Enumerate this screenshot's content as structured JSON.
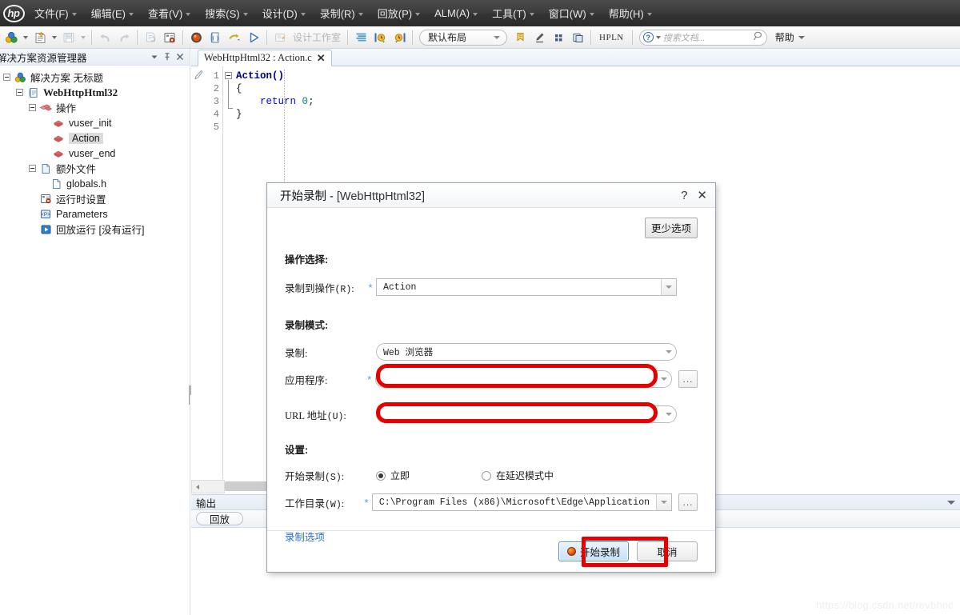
{
  "app": {
    "logo_text": "hp",
    "watermark": "https://blog.csdn.net/revbhnc"
  },
  "menubar": {
    "items": [
      {
        "label": "文件(F)",
        "icon": "chevron-down-icon"
      },
      {
        "label": "编辑(E)",
        "icon": "chevron-down-icon"
      },
      {
        "label": "查看(V)",
        "icon": "chevron-down-icon"
      },
      {
        "label": "搜索(S)",
        "icon": "chevron-down-icon"
      },
      {
        "label": "设计(D)",
        "icon": "chevron-down-icon"
      },
      {
        "label": "录制(R)",
        "icon": "chevron-down-icon"
      },
      {
        "label": "回放(P)",
        "icon": "chevron-down-icon"
      },
      {
        "label": "ALM(A)",
        "icon": "chevron-down-icon"
      },
      {
        "label": "工具(T)",
        "icon": "chevron-down-icon"
      },
      {
        "label": "窗口(W)",
        "icon": "chevron-down-icon"
      },
      {
        "label": "帮助(H)",
        "icon": "chevron-down-icon"
      }
    ]
  },
  "toolbar": {
    "design_studio_label": "设计工作室",
    "hpln_label": "HPLN",
    "layout_value": "默认布局",
    "search_placeholder": "搜索文档...",
    "help_label": "帮助"
  },
  "solution_explorer": {
    "title": "解决方案资源管理器",
    "header_buttons": [
      {
        "name": "dropdown-icon"
      },
      {
        "name": "pin-icon"
      },
      {
        "name": "close-icon"
      }
    ],
    "tree": [
      {
        "label": "解决方案 无标题",
        "icon": "solution-icon",
        "depth": 0,
        "expander": "minus"
      },
      {
        "label": "WebHttpHtml32",
        "icon": "script-icon",
        "depth": 1,
        "expander": "minus",
        "bold": true
      },
      {
        "label": "操作",
        "icon": "actions-folder-icon",
        "depth": 2,
        "expander": "minus"
      },
      {
        "label": "vuser_init",
        "icon": "action-icon",
        "depth": 3,
        "expander": "none"
      },
      {
        "label": "Action",
        "icon": "action-icon",
        "depth": 3,
        "expander": "none",
        "selected": true
      },
      {
        "label": "vuser_end",
        "icon": "action-icon",
        "depth": 3,
        "expander": "none"
      },
      {
        "label": "额外文件",
        "icon": "file-folder-icon",
        "depth": 2,
        "expander": "minus"
      },
      {
        "label": "globals.h",
        "icon": "header-file-icon",
        "depth": 3,
        "expander": "none"
      },
      {
        "label": "运行时设置",
        "icon": "runtime-settings-icon",
        "depth": 2,
        "expander": "none"
      },
      {
        "label": "Parameters",
        "icon": "parameters-icon",
        "depth": 2,
        "expander": "none"
      },
      {
        "label": "回放运行 [没有运行]",
        "icon": "replay-run-icon",
        "depth": 2,
        "expander": "none"
      }
    ]
  },
  "editor": {
    "tab_label": "WebHttpHtml32 : Action.c",
    "tab_close_icon": "close-icon",
    "line_numbers": [
      "1",
      "2",
      "3",
      "4",
      "5"
    ],
    "code_lines": [
      {
        "tokens": [
          {
            "t": "Action()",
            "c": "fn"
          }
        ]
      },
      {
        "tokens": [
          {
            "t": "{",
            "c": ""
          }
        ]
      },
      {
        "tokens": [
          {
            "t": "    ",
            "c": ""
          },
          {
            "t": "return",
            "c": "kw2"
          },
          {
            "t": " ",
            "c": ""
          },
          {
            "t": "0",
            "c": "num"
          },
          {
            "t": ";",
            "c": ""
          }
        ]
      },
      {
        "tokens": [
          {
            "t": "}",
            "c": ""
          }
        ]
      },
      {
        "tokens": [
          {
            "t": "",
            "c": ""
          }
        ]
      }
    ]
  },
  "output_panel": {
    "title": "输出",
    "collapse_icon": "chevron-down-icon",
    "tabs": [
      {
        "label": "回放"
      }
    ]
  },
  "dialog": {
    "title_prefix": "开始录制 - ",
    "title_project": "[WebHttpHtml32]",
    "help_icon": "question-mark-icon",
    "close_icon": "close-icon",
    "more_options_label": "更少选项",
    "section_action": "操作选择:",
    "record_into_label": "录制到操作",
    "record_into_key": "(R)",
    "record_into_value": "Action",
    "section_mode": "录制模式:",
    "record_label": "录制:",
    "record_value": "Web 浏览器",
    "app_label": "应用程序:",
    "app_value": "",
    "url_label": "URL 地址",
    "url_key": "(U)",
    "url_value": "",
    "section_settings": "设置:",
    "start_rec_label": "开始录制",
    "start_rec_key": "(S)",
    "radio_immediate": "立即",
    "radio_delayed": "在延迟模式中",
    "radio_selected": "立即",
    "workdir_label": "工作目录",
    "workdir_key": "(W)",
    "workdir_value": "C:\\Program Files (x86)\\Microsoft\\Edge\\Application",
    "recording_options_link": "录制选项",
    "ellipsis_label": "...",
    "required_marker": "*",
    "buttons": {
      "start": "开始录制",
      "cancel": "取消"
    },
    "colors": {
      "redaction": "#e60000",
      "link": "#2f6fcf",
      "required": "#5b9bd5"
    }
  }
}
